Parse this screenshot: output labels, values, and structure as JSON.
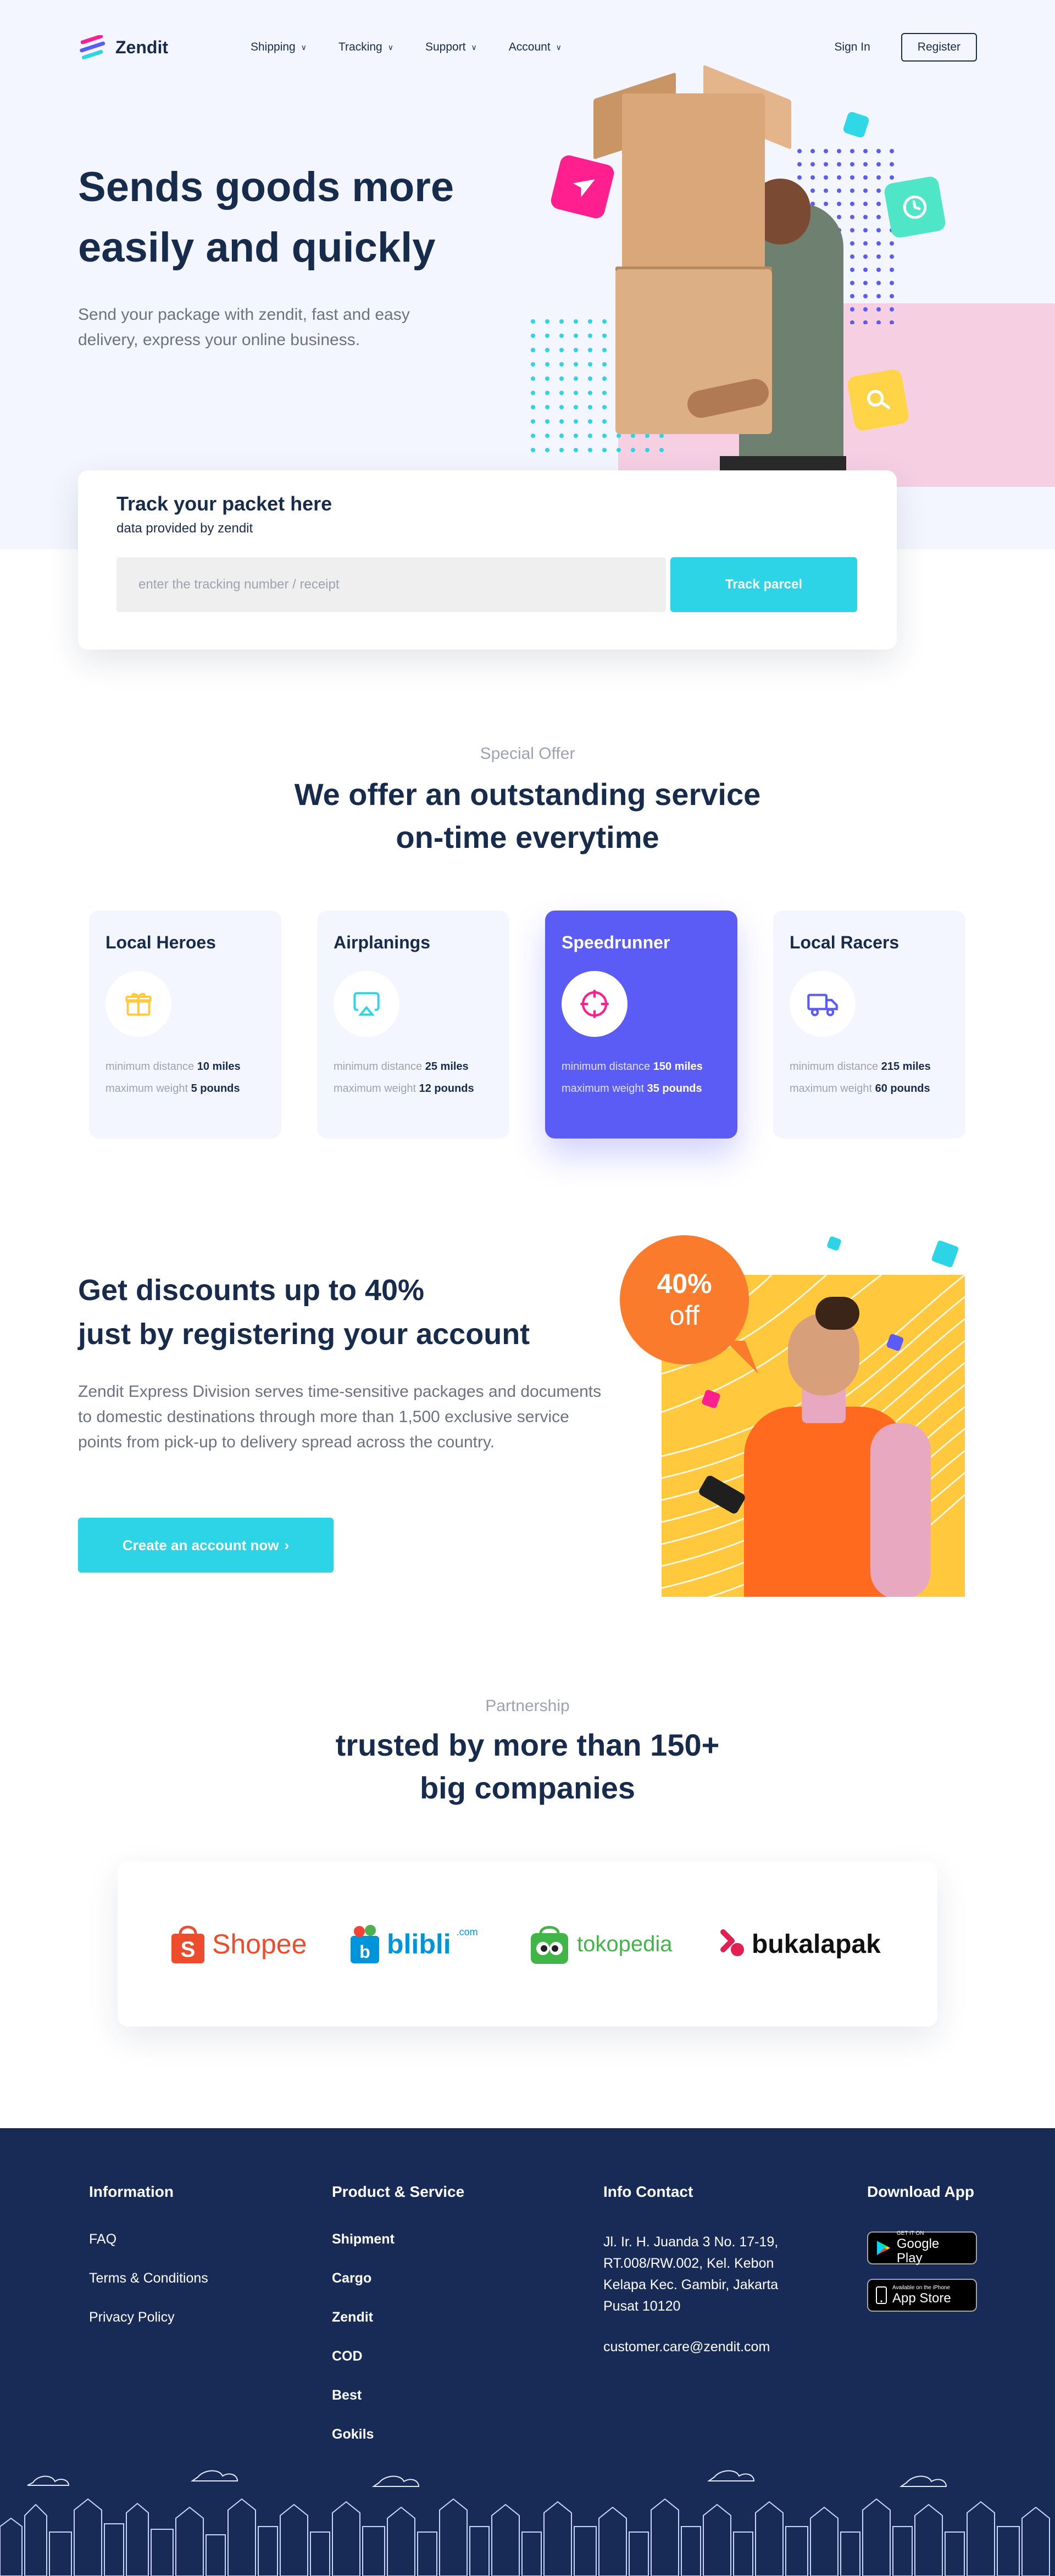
{
  "brand": {
    "name": "Zendit"
  },
  "nav": {
    "items": [
      {
        "label": "Shipping"
      },
      {
        "label": "Tracking"
      },
      {
        "label": "Support"
      },
      {
        "label": "Account"
      }
    ],
    "sign_in": "Sign In",
    "register": "Register"
  },
  "hero": {
    "title_line1": "Sends goods more",
    "title_line2": "easily and quickly",
    "subtitle": "Send your package with zendit, fast and easy delivery, express your online business."
  },
  "track": {
    "title": "Track your packet here",
    "subtitle": "data provided by zendit",
    "placeholder": "enter the tracking number / receipt",
    "button": "Track parcel"
  },
  "services": {
    "eyebrow": "Special Offer",
    "title_line1": "We offer an outstanding service",
    "title_line2": "on-time everytime",
    "distance_label": "minimum distance",
    "weight_label": "maximum weight",
    "items": [
      {
        "name": "Local Heroes",
        "icon": "gift-icon",
        "distance": "10 miles",
        "weight": "5 pounds",
        "active": false
      },
      {
        "name": "Airplanings",
        "icon": "airplay-icon",
        "distance": "25 miles",
        "weight": "12 pounds",
        "active": false
      },
      {
        "name": "Speedrunner",
        "icon": "target-icon",
        "distance": "150 miles",
        "weight": "35 pounds",
        "active": true
      },
      {
        "name": "Local Racers",
        "icon": "truck-icon",
        "distance": "215 miles",
        "weight": "60 pounds",
        "active": false
      }
    ]
  },
  "discount": {
    "title_line1": "Get discounts up to 40%",
    "title_line2": "just by registering your account",
    "body": "Zendit Express Division serves time-sensitive packages and documents to domestic destinations through more than 1,500 exclusive service points from pick-up to delivery spread across the country.",
    "button": "Create an account now",
    "badge_pct": "40%",
    "badge_word": "off"
  },
  "partnership": {
    "eyebrow": "Partnership",
    "title_line1": "trusted by more than 150+",
    "title_line2": "big companies",
    "partners": [
      {
        "name": "Shopee",
        "icon": "shopee-bag-icon"
      },
      {
        "name": "blibli",
        "suffix": ".com",
        "icon": "blibli-bag-icon"
      },
      {
        "name": "tokopedia",
        "icon": "tokopedia-owl-icon"
      },
      {
        "name": "bukalapak",
        "icon": "bukalapak-icon"
      }
    ]
  },
  "footer": {
    "info": {
      "heading": "Information",
      "links": [
        "FAQ",
        "Terms & Conditions",
        "Privacy Policy"
      ]
    },
    "products": {
      "heading": "Product & Service",
      "links": [
        "Shipment",
        "Cargo",
        "Zendit",
        "COD",
        "Best",
        "Gokils"
      ]
    },
    "contact": {
      "heading": "Info Contact",
      "address": "Jl. Ir. H. Juanda 3 No. 17-19, RT.008/RW.002, Kel. Kebon Kelapa Kec. Gambir, Jakarta Pusat 10120",
      "email": "customer.care@zendit.com"
    },
    "download": {
      "heading": "Download App",
      "google_small": "GET IT ON",
      "google_big": "Google Play",
      "apple_small": "Available on the iPhone",
      "apple_big": "App Store"
    }
  },
  "colors": {
    "navy": "#172b4d",
    "cyan": "#2dd4e6",
    "purple": "#5b5cf6",
    "pink": "#ff1f8e",
    "orange": "#f97b2b",
    "yellow": "#ffc83d",
    "footer_bg": "#172b56"
  }
}
